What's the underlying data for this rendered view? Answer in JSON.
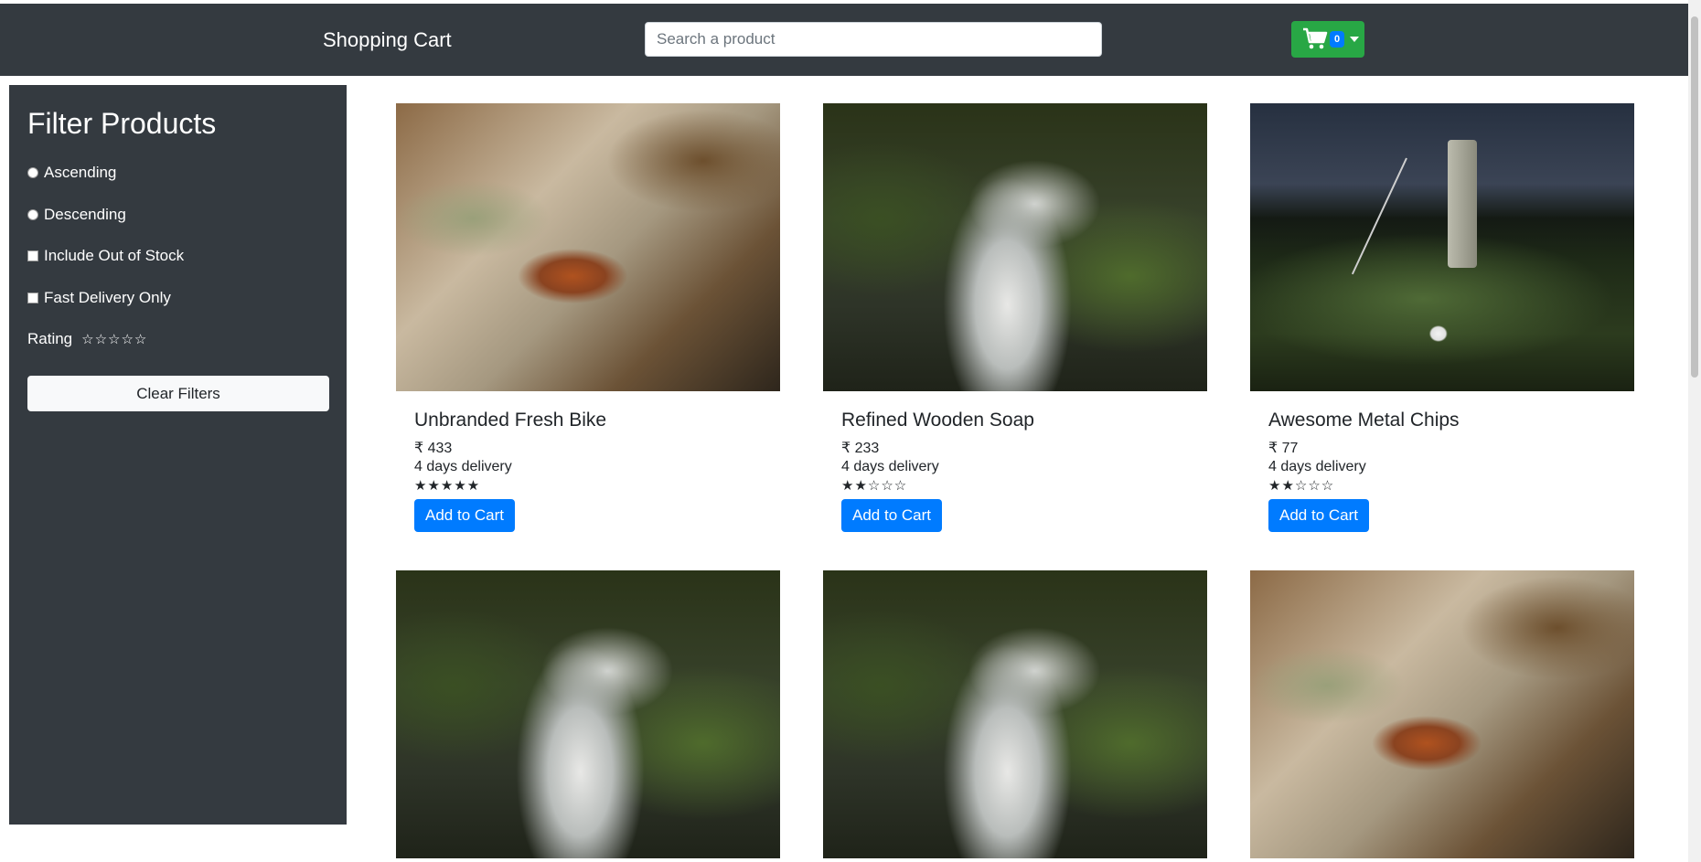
{
  "header": {
    "brand": "Shopping Cart",
    "search_placeholder": "Search a product",
    "cart_count": "0"
  },
  "sidebar": {
    "title": "Filter Products",
    "ascending": "Ascending",
    "descending": "Descending",
    "out_of_stock": "Include Out of Stock",
    "fast_delivery": "Fast Delivery Only",
    "rating_label": "Rating",
    "rating_stars": "☆☆☆☆☆",
    "clear": "Clear Filters"
  },
  "products": [
    {
      "name": "Unbranded Fresh Bike",
      "price": "₹ 433",
      "delivery": "4 days delivery",
      "stars": "★★★★★",
      "button": "Add to Cart",
      "image": "rock"
    },
    {
      "name": "Refined Wooden Soap",
      "price": "₹ 233",
      "delivery": "4 days delivery",
      "stars": "★★☆☆☆",
      "button": "Add to Cart",
      "image": "water"
    },
    {
      "name": "Awesome Metal Chips",
      "price": "₹ 77",
      "delivery": "4 days delivery",
      "stars": "★★☆☆☆",
      "button": "Add to Cart",
      "image": "golf"
    },
    {
      "image": "water"
    },
    {
      "image": "water"
    },
    {
      "image": "rock"
    }
  ],
  "colors": {
    "navbar": "#343a40",
    "cart_button": "#28a745",
    "primary": "#007bff"
  }
}
